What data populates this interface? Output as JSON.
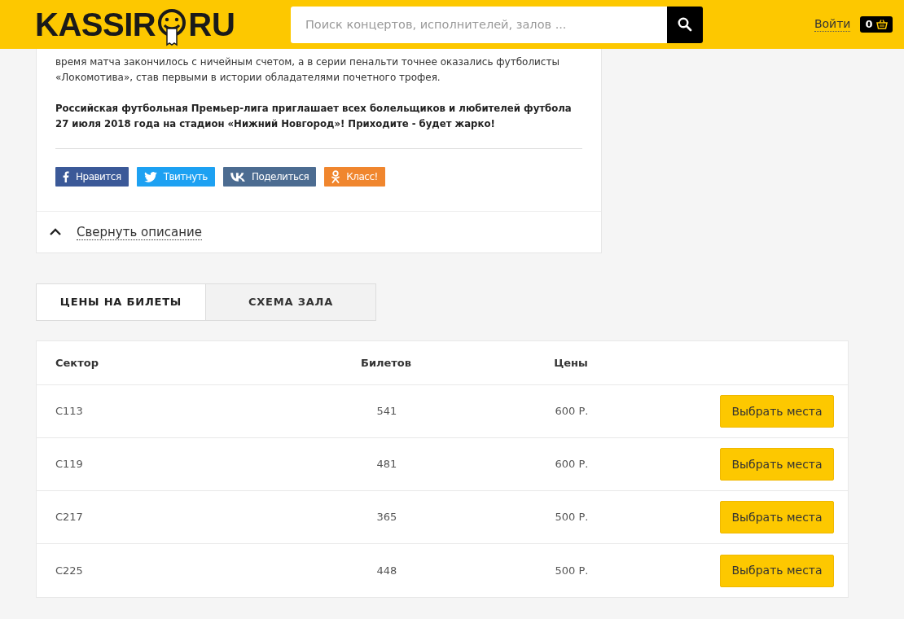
{
  "header": {
    "logo": {
      "left": "KASSIR",
      "right": "RU"
    },
    "search": {
      "placeholder": "Поиск концертов, исполнителей, залов ..."
    },
    "login": "Войти",
    "cart_count": "0"
  },
  "description": {
    "paragraph": "время матча закончилось с ничейным счетом, а в серии пенальти точнее оказались футболисты «Локомотива», став первыми в истории обладателями почетного трофея.",
    "bold_paragraph": "Российская футбольная Премьер-лига приглашает всех болельщиков и любителей футбола 27 июля 2018 года на стадион «Нижний Новгород»! Приходите - будет жарко!",
    "share_buttons": [
      {
        "kind": "facebook",
        "label": "Нравится",
        "color": "#3b5998"
      },
      {
        "kind": "twitter",
        "label": "Твитнуть",
        "color": "#1da1f2"
      },
      {
        "kind": "vk",
        "label": "Поделиться",
        "color": "#4c6c91"
      },
      {
        "kind": "ok",
        "label": "Класс!",
        "color": "#f0862e"
      }
    ],
    "collapse": {
      "label": "Свернуть описание",
      "expanded": true
    }
  },
  "tabs": [
    {
      "label": "ЦЕНЫ НА БИЛЕТЫ",
      "selected": true
    },
    {
      "label": "СХЕМА ЗАЛА",
      "selected": false
    }
  ],
  "table": {
    "columns": [
      "Сектор",
      "Билетов",
      "Цены"
    ],
    "rows": [
      {
        "sector": "С113",
        "tickets": "541",
        "price": "600 Р.",
        "action": "Выбрать места"
      },
      {
        "sector": "С119",
        "tickets": "481",
        "price": "600 Р.",
        "action": "Выбрать места"
      },
      {
        "sector": "С217",
        "tickets": "365",
        "price": "500 Р.",
        "action": "Выбрать места"
      },
      {
        "sector": "С225",
        "tickets": "448",
        "price": "500 Р.",
        "action": "Выбрать места"
      }
    ]
  }
}
